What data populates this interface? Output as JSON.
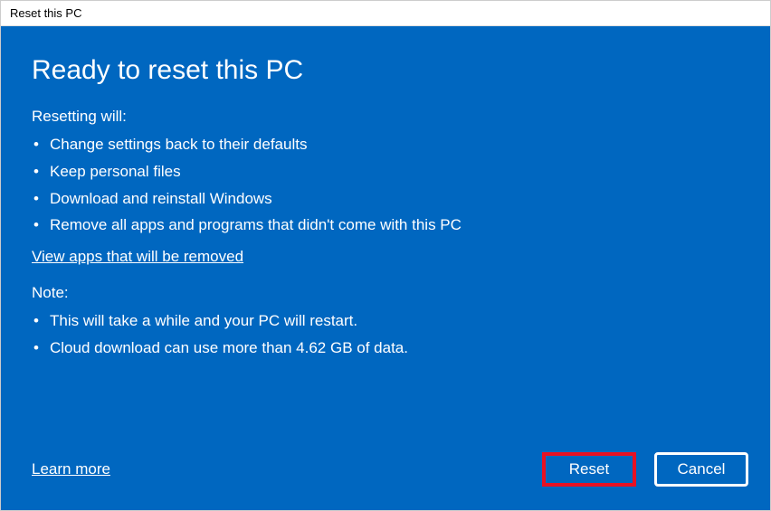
{
  "titlebar": {
    "title": "Reset this PC"
  },
  "heading": "Ready to reset this PC",
  "resetting": {
    "label": "Resetting will:",
    "items": [
      "Change settings back to their defaults",
      "Keep personal files",
      "Download and reinstall Windows",
      "Remove all apps and programs that didn't come with this PC"
    ]
  },
  "view_apps_link": "View apps that will be removed",
  "note": {
    "label": "Note:",
    "items": [
      "This will take a while and your PC will restart.",
      "Cloud download can use more than 4.62 GB of data."
    ]
  },
  "learn_more": "Learn more",
  "buttons": {
    "reset": "Reset",
    "cancel": "Cancel"
  }
}
